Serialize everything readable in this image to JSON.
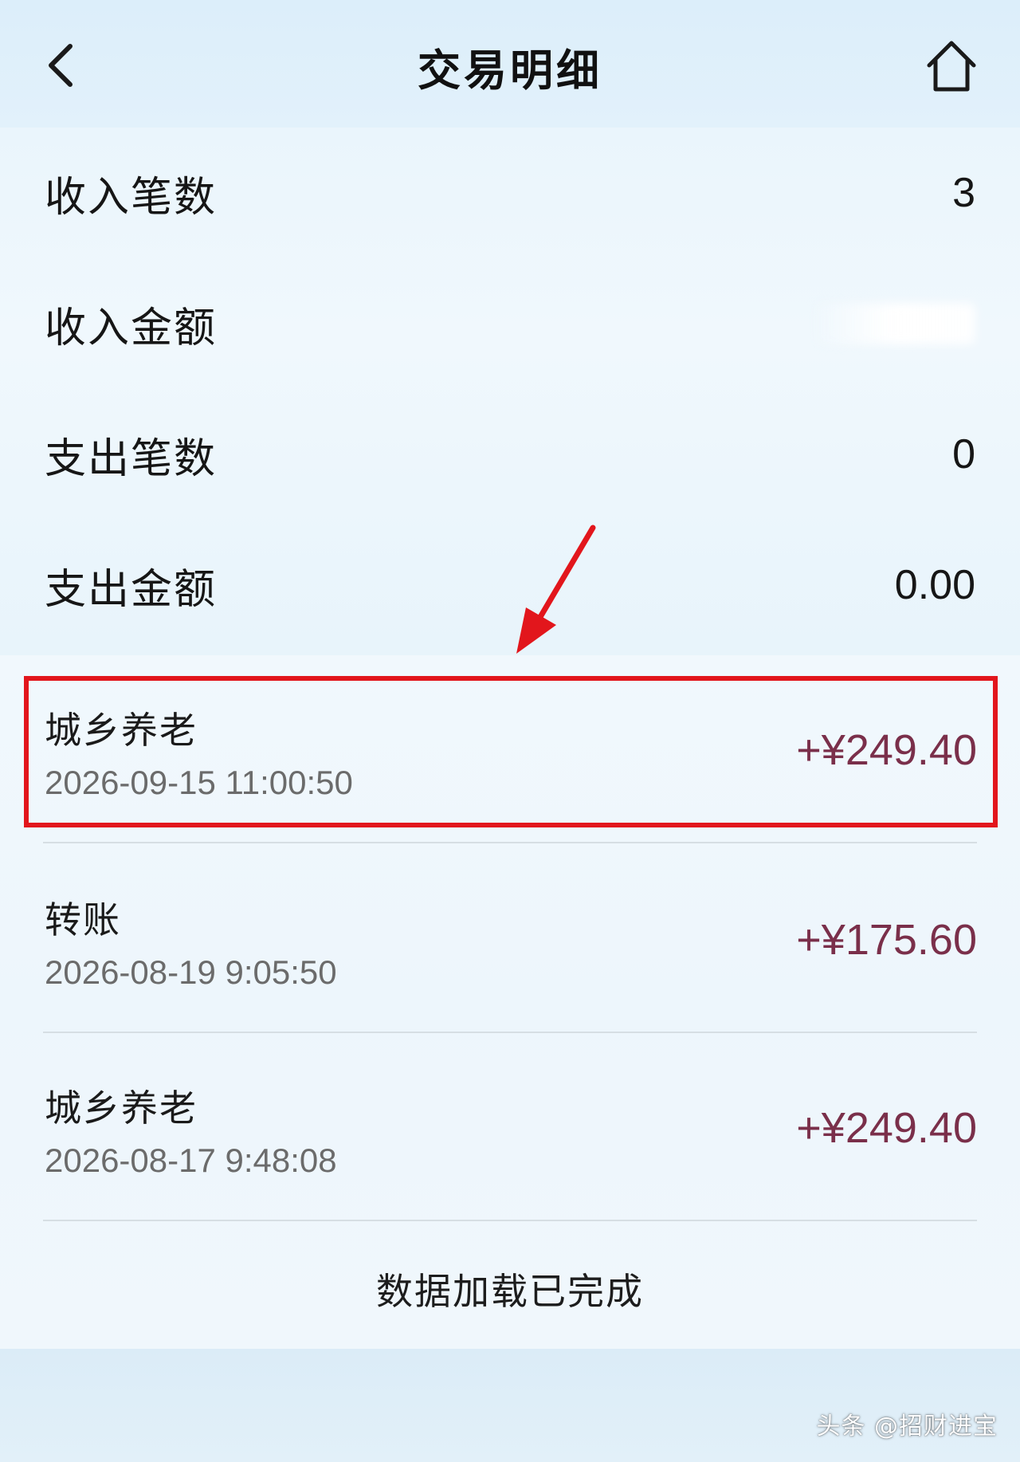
{
  "header": {
    "title": "交易明细",
    "back_icon": "chevron-left-icon",
    "home_icon": "home-icon"
  },
  "summary": {
    "income_count_label": "收入笔数",
    "income_count": "3",
    "income_amount_label": "收入金额",
    "expense_count_label": "支出笔数",
    "expense_count": "0",
    "expense_amount_label": "支出金额",
    "expense_amount": "0.00"
  },
  "transactions": [
    {
      "name": "城乡养老",
      "time": "2026-09-15 11:00:50",
      "amount": "+¥249.40"
    },
    {
      "name": "转账",
      "time": "2026-08-19 9:05:50",
      "amount": "+¥175.60"
    },
    {
      "name": "城乡养老",
      "time": "2026-08-17 9:48:08",
      "amount": "+¥249.40"
    }
  ],
  "list_status": "数据加载已完成",
  "watermark": "头条 @招财进宝",
  "colors": {
    "amount": "#7a2f4a",
    "highlight": "#e2161c",
    "background": "#e8f4fb"
  }
}
